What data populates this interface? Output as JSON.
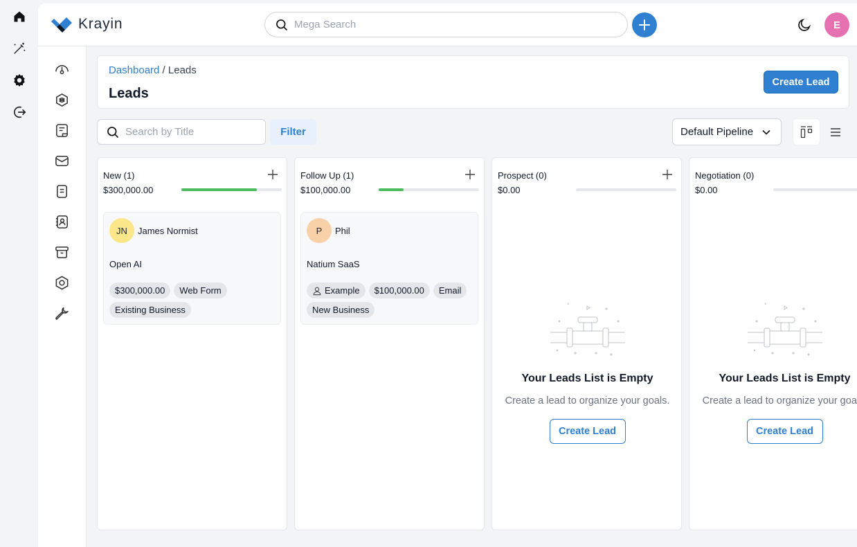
{
  "os_dock": {
    "icons": [
      "home-icon",
      "magic-wand-icon",
      "gear-icon",
      "logout-icon"
    ]
  },
  "header": {
    "brand": "Krayin",
    "search": {
      "placeholder": "Mega Search",
      "value": ""
    },
    "user_initial": "E",
    "colors": {
      "accent": "#2f80d1",
      "avatar": "#e571b1"
    }
  },
  "sidebar": {
    "items": [
      "dashboard-icon",
      "leads-icon",
      "quotes-icon",
      "mail-icon",
      "activities-icon",
      "contacts-icon",
      "products-icon",
      "settings-icon",
      "configuration-icon"
    ]
  },
  "page": {
    "breadcrumb": {
      "link": "Dashboard",
      "separator": " / ",
      "current": "Leads"
    },
    "title": "Leads",
    "create_button": "Create Lead"
  },
  "toolbar": {
    "search_placeholder": "Search by Title",
    "filter_label": "Filter",
    "pipeline": "Default Pipeline"
  },
  "columns": [
    {
      "title": "New (1)",
      "amount": "$300,000.00",
      "progress": 0.75,
      "card": {
        "initials": "JN",
        "avatar_color": "#fbe68a",
        "name": "James Normist",
        "organization": "Open AI",
        "tags": [
          {
            "text": "$300,000.00"
          },
          {
            "text": "Web Form"
          },
          {
            "text": "Existing Business"
          }
        ]
      }
    },
    {
      "title": "Follow Up (1)",
      "amount": "$100,000.00",
      "progress": 0.25,
      "card": {
        "initials": "P",
        "avatar_color": "#f8d1a8",
        "name": "Phil",
        "organization": "Natium SaaS",
        "tags": [
          {
            "text": "Example",
            "icon": "user-icon"
          },
          {
            "text": "$100,000.00"
          },
          {
            "text": "Email"
          },
          {
            "text": "New Business"
          }
        ]
      }
    },
    {
      "title": "Prospect (0)",
      "amount": "$0.00",
      "progress": 0,
      "empty": {
        "title": "Your Leads List is Empty",
        "subtitle": "Create a lead to organize your goals.",
        "button": "Create Lead"
      }
    },
    {
      "title": "Negotiation (0)",
      "amount": "$0.00",
      "progress": 0,
      "empty": {
        "title": "Your Leads List is Empty",
        "subtitle": "Create a lead to organize your goals.",
        "button": "Create Lead"
      }
    }
  ]
}
